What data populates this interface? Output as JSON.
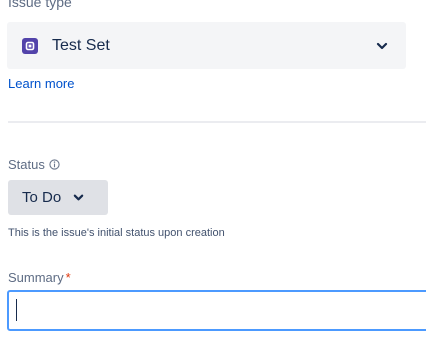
{
  "issue_type": {
    "label": "Issue type",
    "value": "Test Set",
    "icon": "test-set-icon",
    "icon_color": "#5243aa"
  },
  "learn_more": "Learn more",
  "status": {
    "label": "Status",
    "value": "To Do",
    "help_text": "This is the issue's initial status upon creation"
  },
  "summary": {
    "label": "Summary",
    "required_mark": "*",
    "value": ""
  },
  "colors": {
    "link": "#0052cc",
    "focus_border": "#4c9aff",
    "required": "#de350b"
  }
}
